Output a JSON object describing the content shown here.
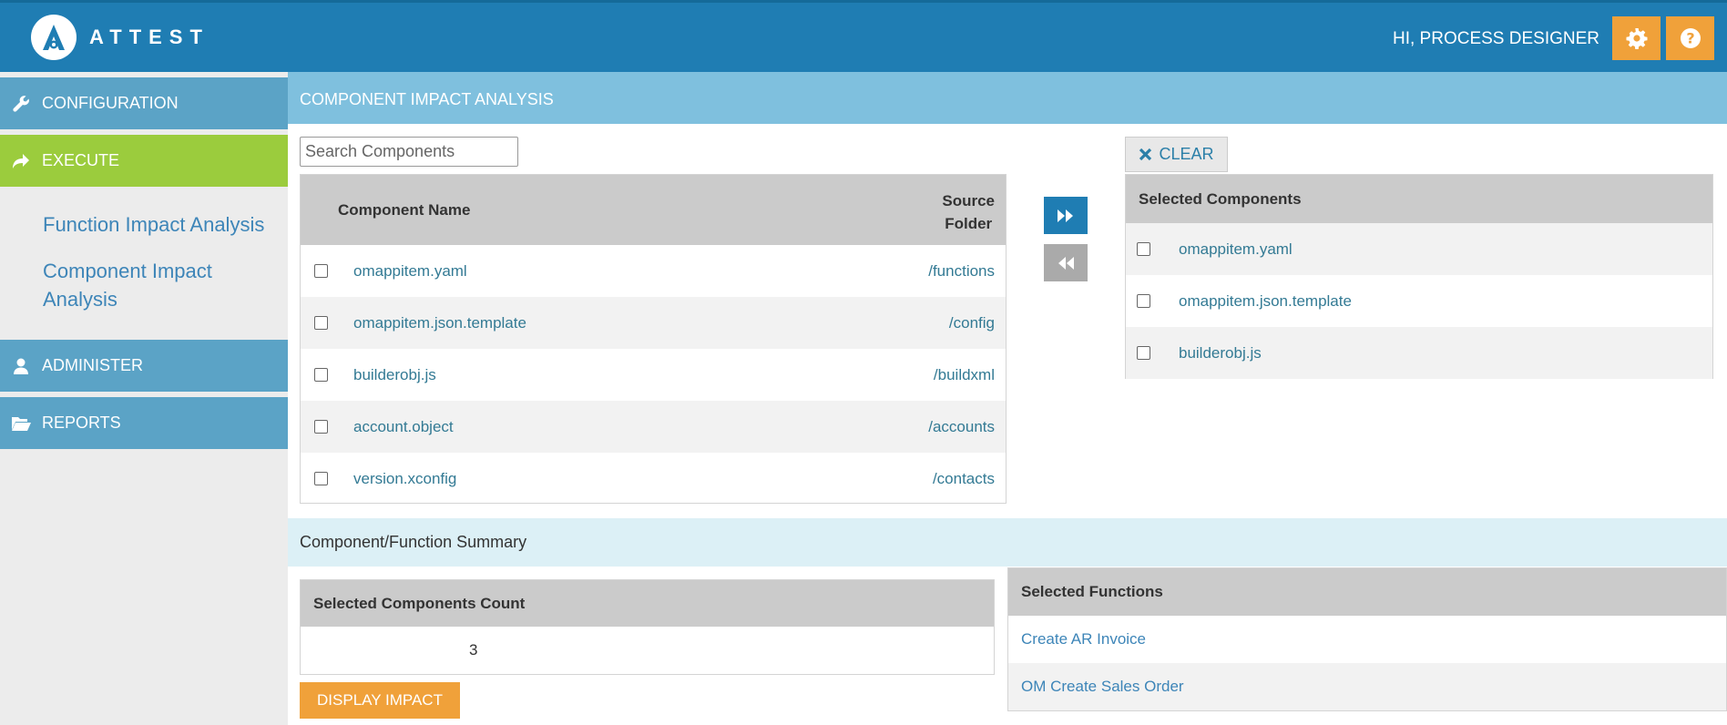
{
  "header": {
    "app_name": "ATTEST",
    "greeting": "HI, PROCESS DESIGNER",
    "icons": [
      "gear-icon",
      "help-icon"
    ],
    "brand_color": "#1f7db3",
    "accent_color": "#f0a13a"
  },
  "sidebar": {
    "configuration": "CONFIGURATION",
    "execute": "EXECUTE",
    "sub_items": [
      "Function Impact Analysis",
      "Component Impact Analysis"
    ],
    "administer": "ADMINISTER",
    "reports": "REPORTS"
  },
  "main": {
    "title": "COMPONENT IMPACT ANALYSIS",
    "search_placeholder": "Search Components",
    "components_table": {
      "col_name": "Component Name",
      "col_folder_line1": "Source",
      "col_folder_line2": "Folder",
      "rows": [
        {
          "name": "omappitem.yaml",
          "folder": "/functions"
        },
        {
          "name": "omappitem.json.template",
          "folder": "/config"
        },
        {
          "name": "builderobj.js",
          "folder": "/buildxml"
        },
        {
          "name": "account.object",
          "folder": "/accounts"
        },
        {
          "name": "version.xconfig",
          "folder": "/contacts"
        }
      ]
    },
    "clear_label": "CLEAR",
    "selected_table": {
      "header": "Selected Components",
      "rows": [
        "omappitem.yaml",
        "omappitem.json.template",
        "builderobj.js"
      ]
    },
    "summary": {
      "title": "Component/Function Summary",
      "count_header": "Selected Components Count",
      "count_value": "3",
      "functions_header": "Selected Functions",
      "functions": [
        "Create AR Invoice",
        "OM Create Sales Order"
      ],
      "display_impact": "DISPLAY IMPACT"
    }
  }
}
